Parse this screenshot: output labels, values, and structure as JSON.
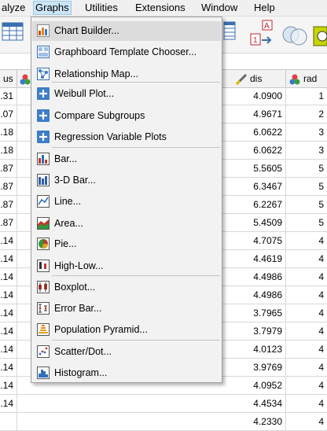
{
  "menubar": {
    "items": [
      {
        "label": "alyze"
      },
      {
        "label": "Graphs"
      },
      {
        "label": "Utilities"
      },
      {
        "label": "Extensions"
      },
      {
        "label": "Window"
      },
      {
        "label": "Help"
      }
    ],
    "active": "Graphs"
  },
  "grid": {
    "headers": {
      "left": "us",
      "dis": "dis",
      "rad": "rad"
    },
    "left_col": [
      ".31",
      ".07",
      ".18",
      ".18",
      ".87",
      ".87",
      ".87",
      ".87",
      ".14",
      ".14",
      ".14",
      ".14",
      ".14",
      ".14",
      ".14",
      ".14",
      ".14",
      ".14"
    ],
    "dis_col": [
      "4.0900",
      "4.9671",
      "6.0622",
      "6.0622",
      "5.5605",
      "6.3467",
      "6.2267",
      "5.4509",
      "4.7075",
      "4.4619",
      "4.4986",
      "4.4986",
      "3.7965",
      "3.7979",
      "4.0123",
      "3.9769",
      "4.0952",
      "4.4534",
      "4.2330"
    ],
    "rad_col": [
      "1",
      "2",
      "3",
      "3",
      "5",
      "5",
      "5",
      "5",
      "4",
      "4",
      "4",
      "4",
      "4",
      "4",
      "4",
      "4",
      "4",
      "4",
      "4"
    ]
  },
  "graphs_menu": {
    "items": [
      {
        "label": "Chart Builder...",
        "icon": "chart-builder-icon"
      },
      {
        "label": "Graphboard Template Chooser...",
        "icon": "graphboard-icon"
      },
      {
        "label": "Relationship Map...",
        "icon": "relationship-map-icon"
      },
      {
        "label": "Weibull Plot...",
        "icon": "plus-icon"
      },
      {
        "label": "Compare Subgroups",
        "icon": "plus-icon"
      },
      {
        "label": "Regression Variable Plots",
        "icon": "plus-icon"
      },
      {
        "label": "Bar...",
        "icon": "bar-chart-icon"
      },
      {
        "label": "3-D Bar...",
        "icon": "3d-bar-chart-icon"
      },
      {
        "label": "Line...",
        "icon": "line-chart-icon"
      },
      {
        "label": "Area...",
        "icon": "area-chart-icon"
      },
      {
        "label": "Pie...",
        "icon": "pie-chart-icon"
      },
      {
        "label": "High-Low...",
        "icon": "high-low-chart-icon"
      },
      {
        "label": "Boxplot...",
        "icon": "boxplot-icon"
      },
      {
        "label": "Error Bar...",
        "icon": "error-bar-icon"
      },
      {
        "label": "Population Pyramid...",
        "icon": "population-pyramid-icon"
      },
      {
        "label": "Scatter/Dot...",
        "icon": "scatter-icon"
      },
      {
        "label": "Histogram...",
        "icon": "histogram-icon"
      }
    ]
  }
}
